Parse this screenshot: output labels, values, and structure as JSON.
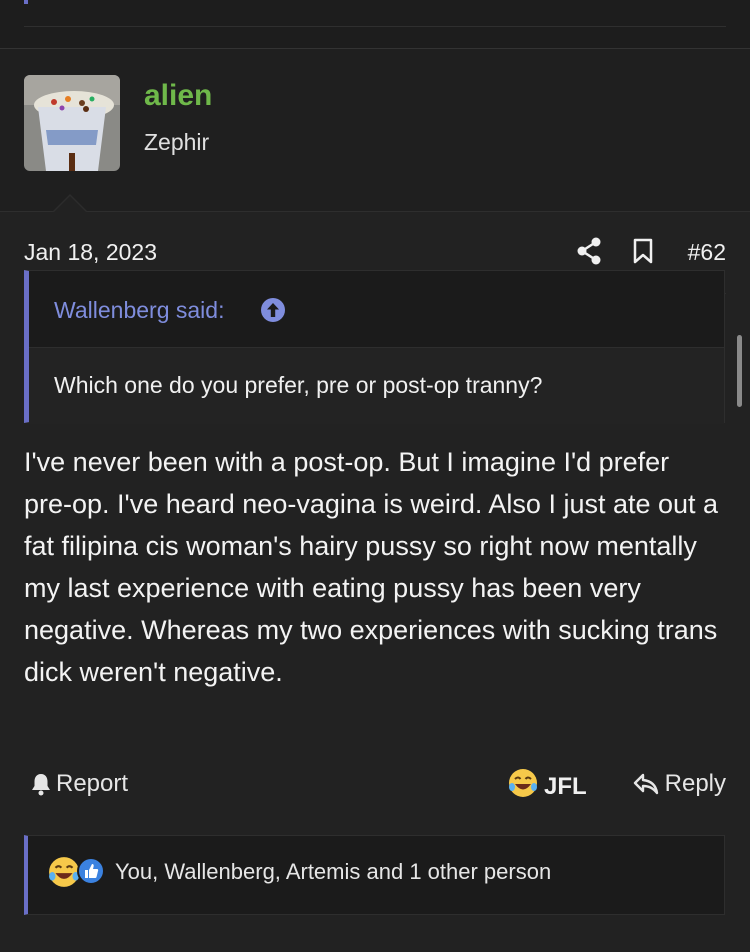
{
  "post": {
    "username": "alien",
    "user_title": "Zephir",
    "date": "Jan 18, 2023",
    "post_number": "#62",
    "quote": {
      "author": "Wallenberg said:",
      "text": "Which one do you prefer, pre or post-op tranny?"
    },
    "message": "I've never been with a post-op. But I imagine I'd prefer pre-op. I've heard neo-vagina is weird. Also I just ate out a fat filipina cis woman's hairy pussy so right now mentally my last experience with eating pussy has been very negative. Whereas my two experiences with sucking trans dick weren't negative.",
    "actions": {
      "report": "Report",
      "reaction": "JFL",
      "reply": "Reply"
    },
    "reactions_summary": "You, Wallenberg, Artemis and 1 other person"
  },
  "icons": {
    "share": "share-icon",
    "bookmark": "bookmark-icon",
    "bell": "bell-icon",
    "reply": "reply-arrow-icon",
    "quote_jump": "arrow-up-circle-icon",
    "laugh": "laughing-emoji-icon",
    "like": "thumbs-up-icon"
  },
  "colors": {
    "username": "#6fb84a",
    "accent": "#6a6fc7",
    "quote_author": "#7f8ddd",
    "background": "#222222"
  }
}
